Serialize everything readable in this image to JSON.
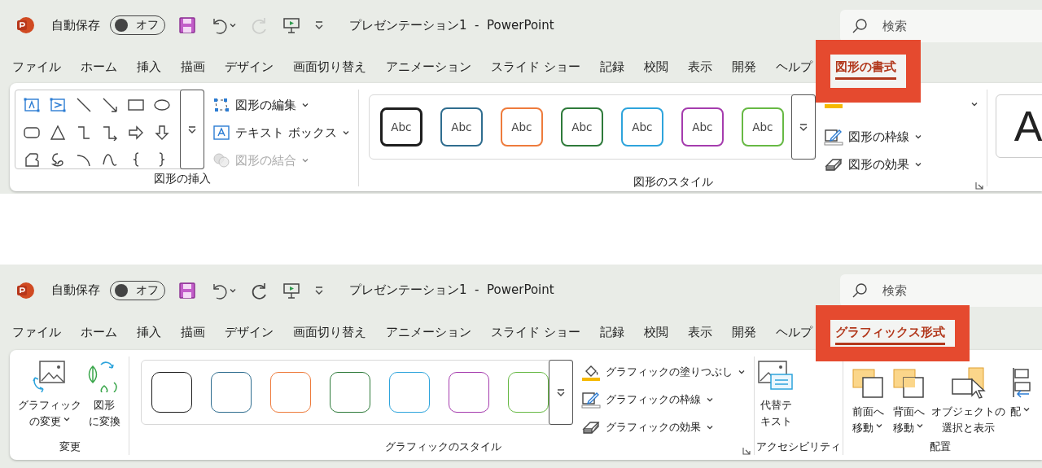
{
  "panels": [
    {
      "titlebar": {
        "autosave_label": "自動保存",
        "autosave": {
          "on": false,
          "label": "オフ"
        },
        "quick_access": [
          {
            "disabled": false
          },
          {
            "disabled": false,
            "dropdown": true
          },
          {
            "disabled": true
          },
          {
            "disabled": false
          },
          {
            "disabled": false
          }
        ],
        "title": "プレゼンテーション1  -  PowerPoint",
        "search": {
          "placeholder": "検索"
        }
      },
      "tabs": [
        {
          "label": "ファイル",
          "selected": false
        },
        {
          "label": "ホーム",
          "selected": false
        },
        {
          "label": "挿入",
          "selected": false
        },
        {
          "label": "描画",
          "selected": false
        },
        {
          "label": "デザイン",
          "selected": false
        },
        {
          "label": "画面切り替え",
          "selected": false
        },
        {
          "label": "アニメーション",
          "selected": false
        },
        {
          "label": "スライド ショー",
          "selected": false
        },
        {
          "label": "記録",
          "selected": false
        },
        {
          "label": "校閲",
          "selected": false
        },
        {
          "label": "表示",
          "selected": false
        },
        {
          "label": "開発",
          "selected": false
        },
        {
          "label": "ヘルプ",
          "selected": false
        },
        {
          "label": "図形の書式",
          "selected": true
        }
      ],
      "groups": [
        {
          "label": "図形の挿入",
          "launcher": false,
          "items": [
            {
              "kind": "shape-gallery"
            },
            {
              "kind": "commands",
              "commands": [
                {
                  "label": "図形の編集",
                  "dropdown": true,
                  "disabled": false
                },
                {
                  "label": "テキスト ボックス",
                  "dropdown": true,
                  "disabled": false
                },
                {
                  "label": "図形の結合",
                  "dropdown": true,
                  "disabled": true
                }
              ]
            }
          ]
        },
        {
          "label": "図形のスタイル",
          "launcher": true,
          "items": [
            {
              "kind": "style-gallery",
              "styles": [
                {
                  "text": "Abc",
                  "color": "#1e1e1e"
                },
                {
                  "text": "Abc",
                  "color": "#2f6d8f"
                },
                {
                  "text": "Abc",
                  "color": "#ee7b3c"
                },
                {
                  "text": "Abc",
                  "color": "#2e7a3a"
                },
                {
                  "text": "Abc",
                  "color": "#2ea4dc"
                },
                {
                  "text": "Abc",
                  "color": "#a53cae"
                },
                {
                  "text": "Abc",
                  "color": "#67b944"
                }
              ]
            },
            {
              "kind": "commands",
              "commands": [
                {
                  "dropdown": true,
                  "disabled": false
                },
                {
                  "label": "図形の枠線",
                  "dropdown": true,
                  "disabled": false
                },
                {
                  "label": "図形の効果",
                  "dropdown": true,
                  "disabled": false
                }
              ]
            }
          ]
        },
        {
          "launcher": false,
          "items": [
            {
              "kind": "wordart",
              "text": "A"
            }
          ]
        }
      ]
    },
    {
      "titlebar": {
        "autosave_label": "自動保存",
        "autosave": {
          "on": false,
          "label": "オフ"
        },
        "quick_access": [
          {
            "disabled": false
          },
          {
            "disabled": false,
            "dropdown": true
          },
          {
            "disabled": false
          },
          {
            "disabled": false
          },
          {
            "disabled": false
          }
        ],
        "title": "プレゼンテーション1  -  PowerPoint",
        "search": {
          "placeholder": "検索"
        }
      },
      "tabs": [
        {
          "label": "ファイル",
          "selected": false
        },
        {
          "label": "ホーム",
          "selected": false
        },
        {
          "label": "挿入",
          "selected": false
        },
        {
          "label": "描画",
          "selected": false
        },
        {
          "label": "デザイン",
          "selected": false
        },
        {
          "label": "画面切り替え",
          "selected": false
        },
        {
          "label": "アニメーション",
          "selected": false
        },
        {
          "label": "スライド ショー",
          "selected": false
        },
        {
          "label": "記録",
          "selected": false
        },
        {
          "label": "校閲",
          "selected": false
        },
        {
          "label": "表示",
          "selected": false
        },
        {
          "label": "開発",
          "selected": false
        },
        {
          "label": "ヘルプ",
          "selected": false
        },
        {
          "label": "グラフィックス形式",
          "selected": true
        }
      ],
      "groups": [
        {
          "label": "変更",
          "launcher": false,
          "items": [
            {
              "kind": "big-buttons",
              "buttons": [
                {
                  "lines": [
                    "グラフィック",
                    "の変更"
                  ],
                  "dropdown": true
                },
                {
                  "lines": [
                    "図形",
                    "に変換"
                  ],
                  "dropdown": false
                }
              ]
            }
          ]
        },
        {
          "label": "グラフィックのスタイル",
          "launcher": true,
          "items": [
            {
              "kind": "style-gallery",
              "styles": [
                {
                  "color": "#1e1e1e"
                },
                {
                  "color": "#2f6d8f"
                },
                {
                  "color": "#ee7b3c"
                },
                {
                  "color": "#2e7a3a"
                },
                {
                  "color": "#2ea4dc"
                },
                {
                  "color": "#a53cae"
                },
                {
                  "color": "#67b944"
                }
              ]
            },
            {
              "kind": "commands",
              "commands": [
                {
                  "label": "グラフィックの塗りつぶし",
                  "dropdown": true,
                  "disabled": false
                },
                {
                  "label": "グラフィックの枠線",
                  "dropdown": true,
                  "disabled": false
                },
                {
                  "label": "グラフィックの効果",
                  "dropdown": true,
                  "disabled": false
                }
              ]
            }
          ]
        },
        {
          "label": "アクセシビリティ",
          "launcher": false,
          "items": [
            {
              "kind": "big-buttons",
              "buttons": [
                {
                  "lines": [
                    "代替テ",
                    "キスト"
                  ],
                  "dropdown": false
                }
              ]
            }
          ]
        },
        {
          "label": "配置",
          "launcher": false,
          "items": [
            {
              "kind": "big-buttons",
              "buttons": [
                {
                  "lines": [
                    "前面へ",
                    "移動"
                  ],
                  "dropdown": true
                },
                {
                  "lines": [
                    "背面へ",
                    "移動"
                  ],
                  "dropdown": true
                },
                {
                  "lines": [
                    "オブジェクトの",
                    "選択と表示"
                  ],
                  "dropdown": false
                },
                {
                  "lines": [
                    "配"
                  ],
                  "dropdown": true
                }
              ]
            }
          ]
        }
      ]
    }
  ]
}
